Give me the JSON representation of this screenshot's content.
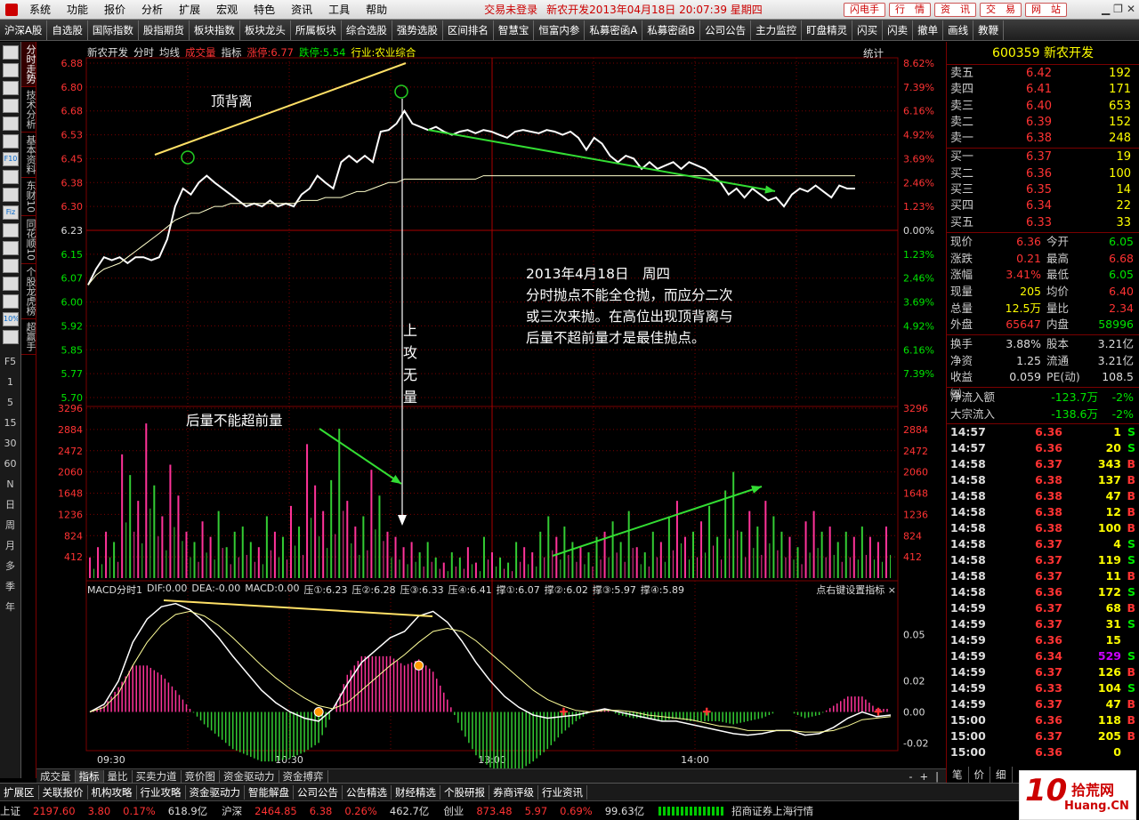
{
  "menubar": {
    "items": [
      "系统",
      "功能",
      "报价",
      "分析",
      "扩展",
      "宏观",
      "特色",
      "资讯",
      "工具",
      "帮助"
    ],
    "status": "交易未登录",
    "title": "新农开发2013年04月18日 20:07:39 星期四",
    "quicklinks": [
      "闪电手",
      "行　情",
      "资　讯",
      "交　易",
      "网　站"
    ]
  },
  "toolbar": {
    "items": [
      "沪深A股",
      "自选股",
      "国际指数",
      "股指期货",
      "板块指数",
      "板块龙头",
      "所属板块",
      "综合选股",
      "强势选股",
      "区间排名",
      "智慧宝",
      "恒富内参",
      "私募密函A",
      "私募密函B",
      "公司公告",
      "主力监控",
      "盯盘精灵",
      "闪买",
      "闪卖",
      "撤单",
      "画线",
      "教鞭"
    ]
  },
  "leftbar": {
    "icons": [
      "list-icon",
      "grid-icon",
      "chart-icon",
      "candle-icon",
      "page-icon",
      "news-icon",
      "fio-icon",
      "doc-icon",
      "f10-icon",
      "fiz-icon",
      "bars-icon",
      "zoom-icon",
      "monitor-icon",
      "compare-icon",
      "rank-icon",
      "percent-icon",
      "pen-icon"
    ],
    "icon_labels": [
      "",
      "",
      "",
      "",
      "",
      "",
      "F10",
      "",
      "",
      "Fiz",
      "",
      "",
      "",
      "",
      "",
      "10%",
      ""
    ],
    "f5_label": "F5",
    "periods": [
      "1",
      "5",
      "15",
      "30",
      "60",
      "N",
      "日",
      "周",
      "月",
      "多",
      "季",
      "年"
    ]
  },
  "vtabs": [
    {
      "label": "分时走势",
      "active": true
    },
    {
      "label": "技术分析",
      "active": false
    },
    {
      "label": "基本资料",
      "active": false
    },
    {
      "label": "东财10",
      "active": false
    },
    {
      "label": "同花顺10",
      "active": false
    },
    {
      "label": "个股龙虎榜",
      "active": false
    },
    {
      "label": "超赢手",
      "active": false
    }
  ],
  "chart_header": {
    "stock": "新农开发",
    "labels": [
      "分时",
      "均线"
    ],
    "volume_label": "成交量",
    "indicator_label": "指标",
    "limit_up": "涨停:6.77",
    "limit_down": "跌停:5.54",
    "industry": "行业:农业综合",
    "stats_label": "统计"
  },
  "macd_header": {
    "items": [
      "MACD分时1",
      "DIF:0.00",
      "DEA:-0.00",
      "MACD:0.00",
      "压①:6.23",
      "压②:6.28",
      "压③:6.33",
      "压④:6.41",
      "撑①:6.07",
      "撑②:6.02",
      "撑③:5.97",
      "撑④:5.89"
    ],
    "hint": "点右键设置指标",
    "close": "×"
  },
  "annotations": {
    "top_divergence": "顶背离",
    "volume_note": "后量不能超前量",
    "vertical_note": "上攻无量",
    "note_lines": [
      "2013年4月18日　周四",
      "分时抛点不能全仓抛，而应分二次",
      "或三次来抛。在高位出现顶背离与",
      "后量不超前量才是最佳抛点。"
    ]
  },
  "bottomtabs": [
    "成交量",
    "指标",
    "量比",
    "买卖力道",
    "竞价图",
    "资金驱动力",
    "资金搏弈"
  ],
  "bottomtabs_active": 1,
  "bottomtabs_nav": [
    "-",
    "+",
    "|"
  ],
  "right_panel": {
    "code": "600359",
    "name": "新农开发",
    "sells": [
      {
        "label": "卖五",
        "price": "6.42",
        "vol": "192"
      },
      {
        "label": "卖四",
        "price": "6.41",
        "vol": "171"
      },
      {
        "label": "卖三",
        "price": "6.40",
        "vol": "653"
      },
      {
        "label": "卖二",
        "price": "6.39",
        "vol": "152"
      },
      {
        "label": "卖一",
        "price": "6.38",
        "vol": "248"
      }
    ],
    "buys": [
      {
        "label": "买一",
        "price": "6.37",
        "vol": "19"
      },
      {
        "label": "买二",
        "price": "6.36",
        "vol": "100"
      },
      {
        "label": "买三",
        "price": "6.35",
        "vol": "14"
      },
      {
        "label": "买四",
        "price": "6.34",
        "vol": "22"
      },
      {
        "label": "买五",
        "price": "6.33",
        "vol": "33"
      }
    ],
    "stats": [
      {
        "l": "现价",
        "v": "6.36",
        "vc": "red",
        "l2": "今开",
        "v2": "6.05",
        "v2c": "grn"
      },
      {
        "l": "涨跌",
        "v": "0.21",
        "vc": "red",
        "l2": "最高",
        "v2": "6.68",
        "v2c": "red"
      },
      {
        "l": "涨幅",
        "v": "3.41%",
        "vc": "red",
        "l2": "最低",
        "v2": "6.05",
        "v2c": "grn"
      },
      {
        "l": "现量",
        "v": "205",
        "vc": "yel",
        "l2": "均价",
        "v2": "6.40",
        "v2c": "red"
      },
      {
        "l": "总量",
        "v": "12.5万",
        "vc": "yel",
        "l2": "量比",
        "v2": "2.34",
        "v2c": "red"
      },
      {
        "l": "外盘",
        "v": "65647",
        "vc": "red",
        "l2": "内盘",
        "v2": "58996",
        "v2c": "grn"
      }
    ],
    "stats2": [
      {
        "l": "换手",
        "v": "3.88%",
        "vc": "wht",
        "l2": "股本",
        "v2": "3.21亿",
        "v2c": "wht"
      },
      {
        "l": "净资",
        "v": "1.25",
        "vc": "wht",
        "l2": "流通",
        "v2": "3.21亿",
        "v2c": "wht"
      },
      {
        "l": "收益㈣",
        "v": "0.059",
        "vc": "wht",
        "l2": "PE(动)",
        "v2": "108.5",
        "v2c": "wht"
      }
    ],
    "flows": [
      {
        "l": "净流入额",
        "v": "-123.7万",
        "p": "-2%"
      },
      {
        "l": "大宗流入",
        "v": "-138.6万",
        "p": "-2%"
      }
    ],
    "ticks": [
      {
        "t": "14:57",
        "p": "6.36",
        "pc": "red",
        "v": "1",
        "s": "S"
      },
      {
        "t": "14:57",
        "p": "6.36",
        "pc": "red",
        "v": "20",
        "s": "S"
      },
      {
        "t": "14:58",
        "p": "6.37",
        "pc": "red",
        "v": "343",
        "s": "B"
      },
      {
        "t": "14:58",
        "p": "6.38",
        "pc": "red",
        "v": "137",
        "s": "B"
      },
      {
        "t": "14:58",
        "p": "6.38",
        "pc": "red",
        "v": "47",
        "s": "B"
      },
      {
        "t": "14:58",
        "p": "6.38",
        "pc": "red",
        "v": "12",
        "s": "B"
      },
      {
        "t": "14:58",
        "p": "6.38",
        "pc": "red",
        "v": "100",
        "s": "B"
      },
      {
        "t": "14:58",
        "p": "6.37",
        "pc": "red",
        "v": "4",
        "s": "S"
      },
      {
        "t": "14:58",
        "p": "6.37",
        "pc": "red",
        "v": "119",
        "s": "S"
      },
      {
        "t": "14:58",
        "p": "6.37",
        "pc": "red",
        "v": "11",
        "s": "B"
      },
      {
        "t": "14:58",
        "p": "6.36",
        "pc": "red",
        "v": "172",
        "s": "S"
      },
      {
        "t": "14:59",
        "p": "6.37",
        "pc": "red",
        "v": "68",
        "s": "B"
      },
      {
        "t": "14:59",
        "p": "6.37",
        "pc": "red",
        "v": "31",
        "s": "S"
      },
      {
        "t": "14:59",
        "p": "6.36",
        "pc": "red",
        "v": "15",
        "s": ""
      },
      {
        "t": "14:59",
        "p": "6.34",
        "pc": "red",
        "v": "529",
        "s": "S"
      },
      {
        "t": "14:59",
        "p": "6.37",
        "pc": "red",
        "v": "126",
        "s": "B"
      },
      {
        "t": "14:59",
        "p": "6.33",
        "pc": "red",
        "v": "104",
        "s": "S"
      },
      {
        "t": "14:59",
        "p": "6.37",
        "pc": "red",
        "v": "47",
        "s": "B"
      },
      {
        "t": "15:00",
        "p": "6.36",
        "pc": "red",
        "v": "118",
        "s": "B"
      },
      {
        "t": "15:00",
        "p": "6.37",
        "pc": "red",
        "v": "205",
        "s": "B"
      },
      {
        "t": "15:00",
        "p": "6.36",
        "pc": "red",
        "v": "0",
        "s": ""
      }
    ],
    "bottom_tabs": [
      "笔",
      "价",
      "细"
    ]
  },
  "ticker": [
    "扩展区",
    "关联报价",
    "机构攻略",
    "行业攻略",
    "资金驱动力",
    "智能解盘",
    "公司公告",
    "公告精选",
    "财经精选",
    "个股研报",
    "券商评级",
    "行业资讯"
  ],
  "indexbar": [
    {
      "nm": "上证",
      "v": "2197.60",
      "c": "3.80",
      "p": "0.17%",
      "amt": "618.9亿"
    },
    {
      "nm": "沪深",
      "v": "2464.85",
      "c": "6.38",
      "p": "0.26%",
      "amt": "462.7亿"
    },
    {
      "nm": "创业",
      "v": "873.48",
      "c": "5.97",
      "p": "0.69%",
      "amt": "99.63亿"
    }
  ],
  "broker": "招商证券上海行情",
  "watermark": {
    "big": "10",
    "cn": "拾荒网",
    "url": "Huang.CN"
  },
  "colors": {
    "up": "#ff3333",
    "down": "#00e600",
    "accent": "#ff0",
    "divergence": "#ffe066",
    "arrow": "#33dd33"
  },
  "chart_data": [
    {
      "type": "line",
      "name": "price",
      "ylim": [
        5.63,
        6.88
      ],
      "yticks": [
        "6.88",
        "6.80",
        "6.68",
        "6.53",
        "6.45",
        "6.38",
        "6.30",
        "6.23",
        "6.15",
        "6.07",
        "6.00",
        "5.92",
        "5.85",
        "5.77",
        "5.70"
      ],
      "pct_ticks": [
        "8.62%",
        "7.39%",
        "6.16%",
        "4.92%",
        "3.69%",
        "2.46%",
        "1.23%",
        "0.00%",
        "1.23%",
        "2.46%",
        "3.69%",
        "4.92%",
        "6.16%",
        "7.39%"
      ],
      "xticks": [
        "09:30",
        "10:30",
        "13:00",
        "14:00"
      ],
      "price": [
        6.05,
        6.1,
        6.14,
        6.13,
        6.14,
        6.12,
        6.14,
        6.14,
        6.13,
        6.14,
        6.2,
        6.3,
        6.36,
        6.34,
        6.38,
        6.4,
        6.38,
        6.36,
        6.34,
        6.32,
        6.3,
        6.31,
        6.3,
        6.32,
        6.3,
        6.31,
        6.3,
        6.34,
        6.36,
        6.4,
        6.38,
        6.36,
        6.44,
        6.46,
        6.44,
        6.46,
        6.44,
        6.55,
        6.56,
        6.6,
        6.68,
        6.6,
        6.58,
        6.56,
        6.58,
        6.55,
        6.53,
        6.55,
        6.56,
        6.54,
        6.56,
        6.55,
        6.53,
        6.52,
        6.55,
        6.56,
        6.55,
        6.54,
        6.56,
        6.55,
        6.53,
        6.55,
        6.52,
        6.48,
        6.52,
        6.5,
        6.46,
        6.44,
        6.46,
        6.45,
        6.42,
        6.44,
        6.42,
        6.43,
        6.44,
        6.42,
        6.44,
        6.43,
        6.42,
        6.4,
        6.38,
        6.34,
        6.36,
        6.33,
        6.36,
        6.34,
        6.32,
        6.33,
        6.3,
        6.34,
        6.36,
        6.35,
        6.37,
        6.35,
        6.33,
        6.37,
        6.36,
        6.36
      ],
      "avg": [
        6.05,
        6.08,
        6.1,
        6.11,
        6.12,
        6.14,
        6.16,
        6.18,
        6.2,
        6.22,
        6.24,
        6.26,
        6.27,
        6.28,
        6.28,
        6.29,
        6.3,
        6.3,
        6.31,
        6.31,
        6.31,
        6.31,
        6.31,
        6.31,
        6.31,
        6.31,
        6.31,
        6.32,
        6.32,
        6.32,
        6.33,
        6.33,
        6.33,
        6.34,
        6.35,
        6.35,
        6.36,
        6.37,
        6.38,
        6.38,
        6.39,
        6.39,
        6.39,
        6.39,
        6.39,
        6.39,
        6.39,
        6.39,
        6.39,
        6.39,
        6.4,
        6.4,
        6.4,
        6.4,
        6.4,
        6.4,
        6.4,
        6.4,
        6.4,
        6.4,
        6.4,
        6.4,
        6.4,
        6.4,
        6.4,
        6.4,
        6.4,
        6.4,
        6.4,
        6.4,
        6.4,
        6.4,
        6.4,
        6.4,
        6.4,
        6.4,
        6.4,
        6.4,
        6.4,
        6.4,
        6.4,
        6.4,
        6.4,
        6.4,
        6.4,
        6.4,
        6.4,
        6.4,
        6.4,
        6.4,
        6.4,
        6.4,
        6.4,
        6.4,
        6.4,
        6.4,
        6.4,
        6.4
      ]
    },
    {
      "type": "bar",
      "name": "volume",
      "ylim": [
        0,
        3296
      ],
      "yticks": [
        "3296",
        "2884",
        "2472",
        "2060",
        "1648",
        "1236",
        "824",
        "412"
      ],
      "values": [
        400,
        600,
        900,
        700,
        2400,
        2000,
        1500,
        3000,
        1800,
        1200,
        2200,
        1600,
        900,
        700,
        1100,
        800,
        1300,
        600,
        900,
        1000,
        700,
        600,
        1200,
        900,
        800,
        1400,
        1000,
        2600,
        1800,
        1300,
        1900,
        2900,
        1500,
        1000,
        1200,
        2100,
        1600,
        900,
        800,
        600,
        700,
        500,
        700,
        400,
        300,
        500,
        400,
        600,
        300,
        800,
        500,
        400,
        300,
        700,
        600,
        500,
        900,
        1200,
        800,
        1000,
        700,
        600,
        500,
        800,
        900,
        1100,
        700,
        1300,
        600,
        500,
        900,
        700,
        1200,
        1500,
        800,
        900,
        1100,
        1400,
        800,
        1700,
        2060,
        900,
        1300,
        1000,
        1500,
        1200,
        900,
        800,
        600,
        1100,
        1300,
        900,
        1000,
        700,
        900,
        800,
        1000,
        800,
        700,
        1000
      ]
    },
    {
      "type": "line",
      "name": "macd",
      "ylim": [
        -0.025,
        0.075
      ],
      "yticks": [
        "0.05",
        "0.02",
        "0.00",
        "-0.02"
      ],
      "dif": [
        0.0,
        0.005,
        0.02,
        0.045,
        0.06,
        0.068,
        0.07,
        0.066,
        0.058,
        0.048,
        0.036,
        0.025,
        0.014,
        0.006,
        0.0,
        -0.004,
        -0.006,
        0.002,
        0.018,
        0.032,
        0.04,
        0.048,
        0.052,
        0.062,
        0.065,
        0.058,
        0.046,
        0.032,
        0.02,
        0.01,
        0.003,
        -0.002,
        -0.004,
        -0.003,
        -0.002,
        0.0,
        0.002,
        0.0,
        -0.002,
        -0.004,
        -0.006,
        -0.006,
        -0.008,
        -0.01,
        -0.012,
        -0.014,
        -0.015,
        -0.014,
        -0.012,
        -0.012,
        -0.015,
        -0.014,
        -0.01,
        -0.004,
        0.0,
        -0.003,
        -0.002
      ],
      "dea": [
        0.0,
        0.003,
        0.012,
        0.03,
        0.045,
        0.056,
        0.063,
        0.065,
        0.062,
        0.056,
        0.048,
        0.039,
        0.03,
        0.022,
        0.015,
        0.009,
        0.004,
        0.002,
        0.006,
        0.014,
        0.022,
        0.03,
        0.037,
        0.045,
        0.052,
        0.054,
        0.052,
        0.046,
        0.038,
        0.03,
        0.022,
        0.014,
        0.008,
        0.004,
        0.001,
        0.0,
        0.001,
        0.001,
        0.0,
        -0.002,
        -0.003,
        -0.004,
        -0.005,
        -0.007,
        -0.009,
        -0.01,
        -0.012,
        -0.012,
        -0.012,
        -0.012,
        -0.013,
        -0.013,
        -0.012,
        -0.009,
        -0.005,
        -0.004,
        -0.003
      ],
      "hist": [
        0.0,
        0.004,
        0.016,
        0.03,
        0.03,
        0.024,
        0.014,
        0.002,
        -0.008,
        -0.016,
        -0.024,
        -0.028,
        -0.032,
        -0.032,
        -0.03,
        -0.026,
        -0.02,
        0.0,
        0.024,
        0.036,
        0.036,
        0.036,
        0.03,
        0.034,
        0.026,
        0.008,
        -0.012,
        -0.028,
        -0.036,
        -0.04,
        -0.038,
        -0.032,
        -0.024,
        -0.014,
        -0.006,
        0.0,
        0.002,
        -0.002,
        -0.004,
        -0.004,
        -0.006,
        -0.004,
        -0.006,
        -0.006,
        -0.006,
        -0.008,
        -0.006,
        -0.004,
        0.0,
        0.0,
        -0.004,
        -0.002,
        0.004,
        0.01,
        0.01,
        0.002,
        0.002
      ]
    }
  ]
}
